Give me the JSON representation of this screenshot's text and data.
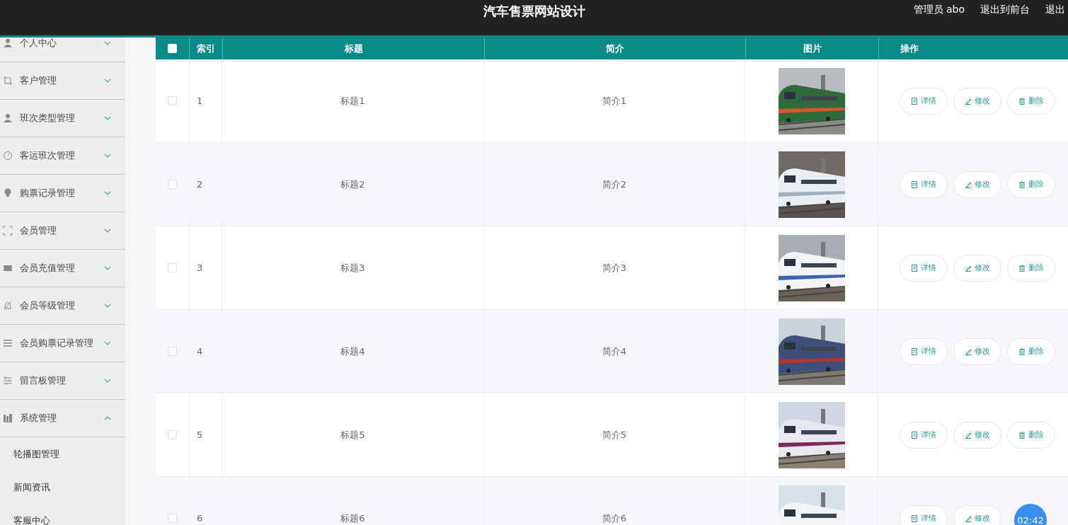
{
  "header": {
    "title": "汽车售票网站设计",
    "links": [
      "管理员 abo",
      "退出到前台",
      "退出"
    ]
  },
  "sidebar": {
    "items": [
      {
        "label": "个人中心",
        "expanded": false
      },
      {
        "label": "客户管理",
        "expanded": false
      },
      {
        "label": "班次类型管理",
        "expanded": false
      },
      {
        "label": "客运班次管理",
        "expanded": false
      },
      {
        "label": "购票记录管理",
        "expanded": false
      },
      {
        "label": "会员管理",
        "expanded": false
      },
      {
        "label": "会员充值管理",
        "expanded": false
      },
      {
        "label": "会员等级管理",
        "expanded": false
      },
      {
        "label": "会员购票记录管理",
        "expanded": false
      },
      {
        "label": "留言板管理",
        "expanded": false
      },
      {
        "label": "系统管理",
        "expanded": true,
        "children": [
          "轮播图管理",
          "新闻资讯",
          "客服中心"
        ]
      }
    ]
  },
  "table": {
    "select_all": {
      "checked": false
    },
    "columns": [
      "索引",
      "标题",
      "简介",
      "图片",
      "操作"
    ],
    "rows": [
      {
        "checked": false,
        "index": "1",
        "title": "标题1",
        "intro": "简介1",
        "actions": [
          "详情",
          "修改",
          "删除"
        ]
      },
      {
        "checked": false,
        "index": "2",
        "title": "标题2",
        "intro": "简介2",
        "actions": [
          "详情",
          "修改",
          "删除"
        ]
      },
      {
        "checked": false,
        "index": "3",
        "title": "标题3",
        "intro": "简介3",
        "actions": [
          "详情",
          "修改",
          "删除"
        ]
      },
      {
        "checked": false,
        "index": "4",
        "title": "标题4",
        "intro": "简介4",
        "actions": [
          "详情",
          "修改",
          "删除"
        ]
      },
      {
        "checked": false,
        "index": "5",
        "title": "标题5",
        "intro": "简介5",
        "actions": [
          "详情",
          "修改",
          "删除"
        ]
      },
      {
        "checked": false,
        "index": "6",
        "title": "标题6",
        "intro": "简介6",
        "actions": [
          "详情",
          "修改"
        ]
      }
    ]
  },
  "timer": "02:42"
}
